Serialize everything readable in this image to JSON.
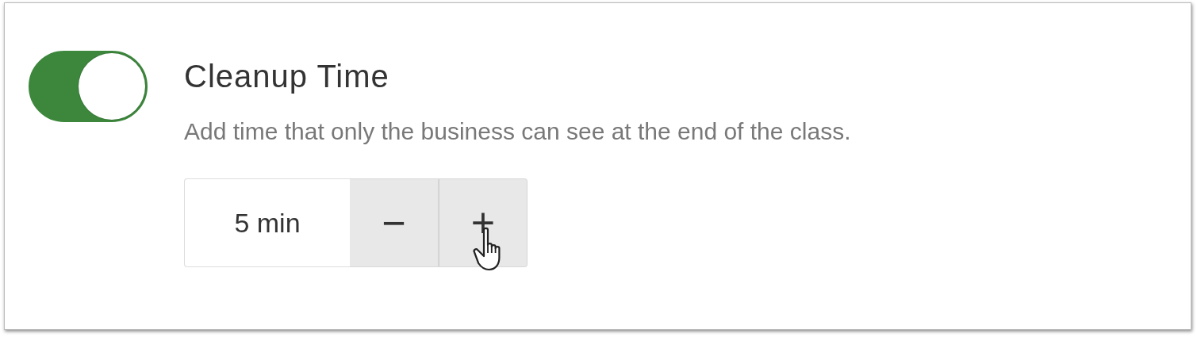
{
  "setting": {
    "on": true,
    "title": "Cleanup Time",
    "description": "Add time that only the business can see at the end of the class.",
    "stepper": {
      "value": "5 min",
      "decrement": "−",
      "increment": "+"
    }
  }
}
